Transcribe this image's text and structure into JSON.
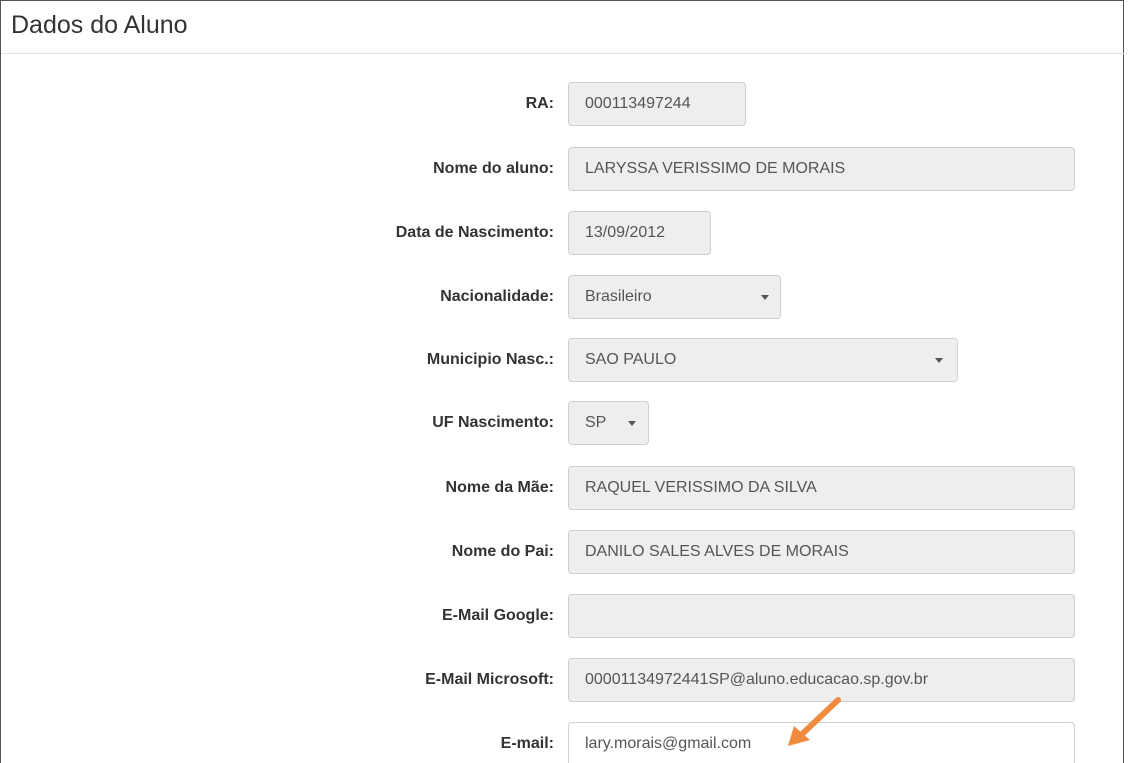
{
  "panel": {
    "title": "Dados do Aluno"
  },
  "form": {
    "ra": {
      "label": "RA:",
      "value": "000113497244"
    },
    "nome_aluno": {
      "label": "Nome do aluno:",
      "value": "LARYSSA VERISSIMO DE MORAIS"
    },
    "data_nascimento": {
      "label": "Data de Nascimento:",
      "value": "13/09/2012"
    },
    "nacionalidade": {
      "label": "Nacionalidade:",
      "value": "Brasileiro"
    },
    "municipio_nasc": {
      "label": "Municipio Nasc.:",
      "value": "SAO PAULO"
    },
    "uf_nascimento": {
      "label": "UF Nascimento:",
      "value": "SP"
    },
    "nome_mae": {
      "label": "Nome da Mãe:",
      "value": "RAQUEL VERISSIMO DA SILVA"
    },
    "nome_pai": {
      "label": "Nome do Pai:",
      "value": "DANILO SALES ALVES DE MORAIS"
    },
    "email_google": {
      "label": "E-Mail Google:",
      "value": ""
    },
    "email_microsoft": {
      "label": "E-Mail Microsoft:",
      "value": "00001134972441SP@aluno.educacao.sp.gov.br"
    },
    "email": {
      "label": "E-mail:",
      "value": "lary.morais@gmail.com"
    }
  },
  "colors": {
    "readonly_bg": "#eeeeee",
    "annotation_arrow": "#f08a3c"
  },
  "icons": {
    "select_caret": "caret-down-icon",
    "annotation": "arrow-annotation-icon"
  }
}
